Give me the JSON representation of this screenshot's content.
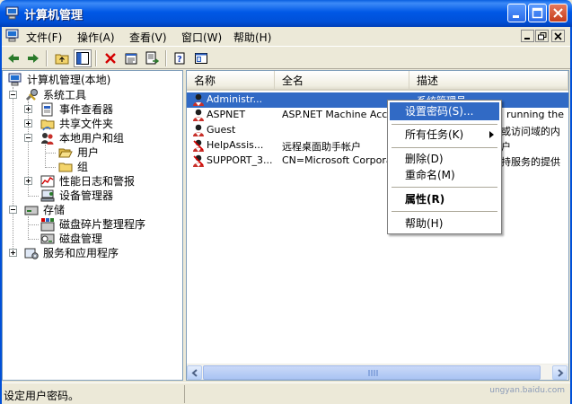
{
  "window": {
    "title": "计算机管理",
    "accent": "#0058e6"
  },
  "menubar": {
    "items": [
      {
        "label": "文件(F)"
      },
      {
        "label": "操作(A)"
      },
      {
        "label": "查看(V)"
      },
      {
        "label": "窗口(W)"
      },
      {
        "label": "帮助(H)"
      }
    ]
  },
  "toolbar": {
    "icons": [
      "back-arrow-icon",
      "forward-arrow-icon",
      "up-folder-icon",
      "show-hide-tree-icon",
      "delete-x-icon",
      "properties-icon",
      "export-list-icon",
      "help-icon",
      "new-window-icon"
    ]
  },
  "tree": {
    "items": [
      {
        "label": "计算机管理(本地)",
        "icon": "computer-icon"
      },
      {
        "label": "系统工具",
        "icon": "tools-icon"
      },
      {
        "label": "事件查看器",
        "icon": "event-viewer-icon"
      },
      {
        "label": "共享文件夹",
        "icon": "shared-folder-icon"
      },
      {
        "label": "本地用户和组",
        "icon": "users-group-icon"
      },
      {
        "label": "用户",
        "icon": "folder-open-icon"
      },
      {
        "label": "组",
        "icon": "folder-icon"
      },
      {
        "label": "性能日志和警报",
        "icon": "performance-icon"
      },
      {
        "label": "设备管理器",
        "icon": "device-manager-icon"
      },
      {
        "label": "存储",
        "icon": "storage-icon"
      },
      {
        "label": "磁盘碎片整理程序",
        "icon": "defrag-icon"
      },
      {
        "label": "磁盘管理",
        "icon": "disk-management-icon"
      },
      {
        "label": "服务和应用程序",
        "icon": "services-icon"
      }
    ]
  },
  "list": {
    "columns": [
      "名称",
      "全名",
      "描述"
    ],
    "rows": [
      {
        "name": "Administr...",
        "fullname": "",
        "description": "系统管理员",
        "selected": true
      },
      {
        "name": "ASPNET",
        "fullname": "ASP.NET Machine Account",
        "description": "running the"
      },
      {
        "name": "Guest",
        "fullname": "",
        "description": "或访问域的内"
      },
      {
        "name": "HelpAssis...",
        "fullname": "远程桌面助手帐户",
        "description": "户"
      },
      {
        "name": "SUPPORT_3...",
        "fullname": "CN=Microsoft Corporation",
        "description": "持服务的提供"
      }
    ]
  },
  "context_menu": {
    "items": [
      {
        "label": "设置密码(S)...",
        "hover": true
      },
      {
        "label": "所有任务(K)",
        "submenu": true
      },
      {
        "label": "删除(D)"
      },
      {
        "label": "重命名(M)"
      },
      {
        "label": "属性(R)",
        "bold": true
      },
      {
        "label": "帮助(H)"
      }
    ]
  },
  "statusbar": {
    "text": "设定用户密码。",
    "watermark": "ungyan.baidu.com"
  }
}
